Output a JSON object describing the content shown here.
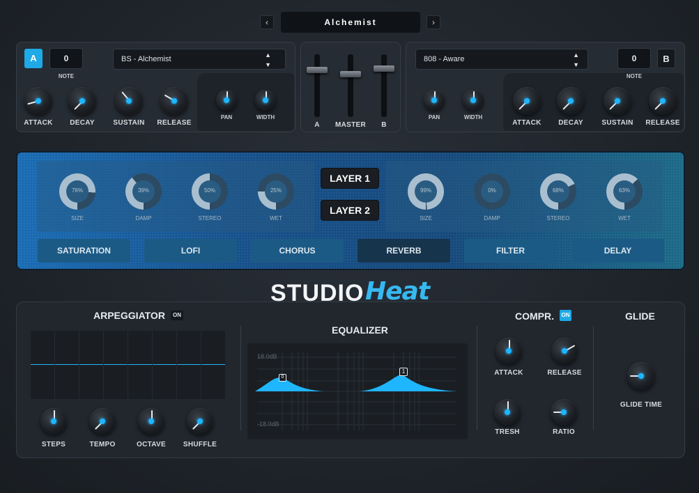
{
  "preset": {
    "prev": "‹",
    "next": "›",
    "name": "Alchemist"
  },
  "layerA": {
    "badge": "A",
    "note_value": "0",
    "note_label": "NOTE",
    "sample": "BS - Alchemist",
    "knobs": [
      {
        "label": "ATTACK"
      },
      {
        "label": "DECAY"
      },
      {
        "label": "SUSTAIN"
      },
      {
        "label": "RELEASE"
      }
    ],
    "pan_label": "PAN",
    "width_label": "WIDTH"
  },
  "mixer": {
    "labels": [
      "A",
      "MASTER",
      "B"
    ]
  },
  "layerB": {
    "badge": "B",
    "note_value": "0",
    "note_label": "NOTE",
    "sample": "808 - Aware",
    "knobs": [
      {
        "label": "ATTACK"
      },
      {
        "label": "DECAY"
      },
      {
        "label": "SUSTAIN"
      },
      {
        "label": "RELEASE"
      }
    ],
    "pan_label": "PAN",
    "width_label": "WIDTH"
  },
  "fx": {
    "left_rings": [
      {
        "label": "SIZE",
        "value": "76%"
      },
      {
        "label": "DAMP",
        "value": "39%"
      },
      {
        "label": "STEREO",
        "value": "50%"
      },
      {
        "label": "WET",
        "value": "25%"
      }
    ],
    "right_rings": [
      {
        "label": "SIZE",
        "value": "99%"
      },
      {
        "label": "DAMP",
        "value": "0%"
      },
      {
        "label": "STEREO",
        "value": "68%"
      },
      {
        "label": "WET",
        "value": "63%"
      }
    ],
    "layer1": "LAYER 1",
    "layer2": "LAYER 2",
    "tabs": [
      "SATURATION",
      "LOFI",
      "CHORUS",
      "REVERB",
      "FILTER",
      "DELAY"
    ],
    "active_tab": "REVERB"
  },
  "logo": {
    "studio": "STUDIO",
    "heat": "Heat"
  },
  "arp": {
    "title": "ARPEGGIATOR",
    "on": "ON",
    "knobs": [
      "STEPS",
      "TEMPO",
      "OCTAVE",
      "SHUFFLE"
    ]
  },
  "eq": {
    "title": "EQUALIZER",
    "top": "18.0dB",
    "bottom": "-18.0dB",
    "node1": "1",
    "node0": "0"
  },
  "comp": {
    "title": "COMPR.",
    "on": "ON",
    "knobs": [
      "ATTACK",
      "RELEASE",
      "TRESH",
      "RATIO"
    ]
  },
  "glide": {
    "title": "GLIDE",
    "knob": "GLIDE TIME"
  },
  "colors": {
    "accent": "#1fb6ff",
    "active_tab": "#17344d"
  }
}
